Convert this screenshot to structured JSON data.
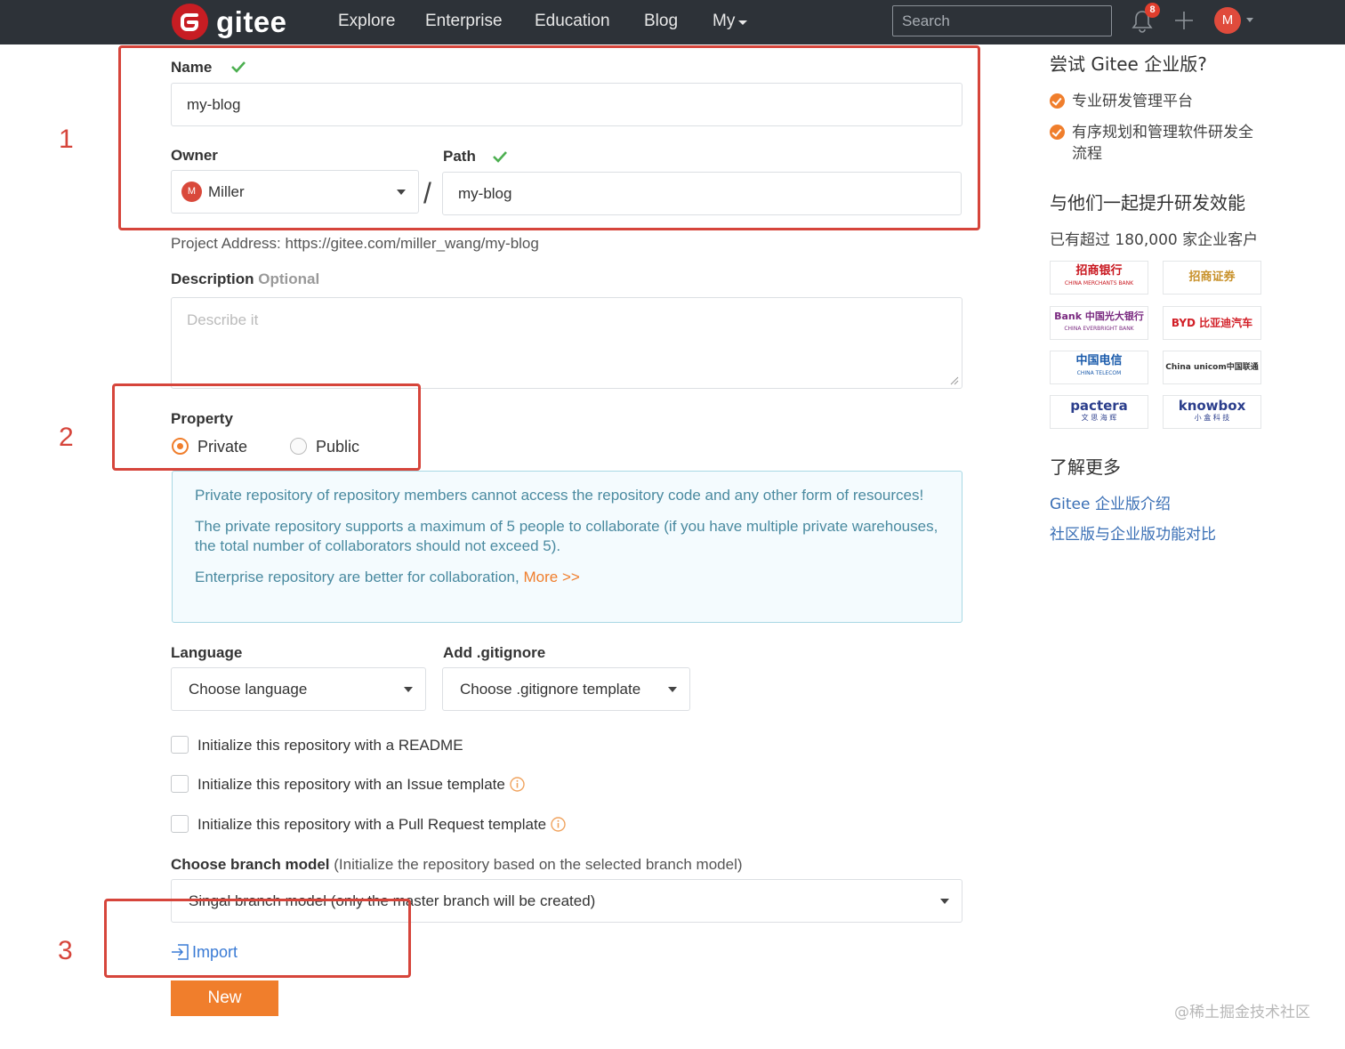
{
  "header": {
    "brand": "gitee",
    "nav": [
      "Explore",
      "Enterprise",
      "Education",
      "Blog",
      "My"
    ],
    "search_placeholder": "Search",
    "notification_count": "8",
    "avatar_initial": "M",
    "icons": [
      "gitee-logo-icon",
      "bell-icon",
      "plus-icon",
      "chevron-down-icon"
    ]
  },
  "form": {
    "name_label": "Name",
    "name_value": "my-blog",
    "owner_label": "Owner",
    "owner_avatar": "M",
    "owner_value": "Miller",
    "path_separator": "/",
    "path_label": "Path",
    "path_value": "my-blog",
    "project_address": "Project Address: https://gitee.com/miller_wang/my-blog",
    "description_label": "Description",
    "description_optional": "Optional",
    "description_placeholder": "Describe it",
    "property_label": "Property",
    "property_options": [
      {
        "label": "Private",
        "selected": true
      },
      {
        "label": "Public",
        "selected": false
      }
    ],
    "info": {
      "line1": "Private repository of repository members cannot access the repository code and any other form of resources!",
      "line2": "The private repository supports a maximum of 5 people to collaborate (if you have multiple private warehouses, the total number of collaborators should not exceed 5).",
      "line3": "Enterprise repository are better for collaboration,",
      "more_link": "More >>"
    },
    "language_label": "Language",
    "language_value": "Choose language",
    "gitignore_label": "Add .gitignore",
    "gitignore_value": "Choose .gitignore template",
    "checkboxes": [
      {
        "label": "Initialize this repository with a README",
        "checked": false,
        "info": false
      },
      {
        "label": "Initialize this repository with an Issue template",
        "checked": false,
        "info": true
      },
      {
        "label": "Initialize this repository with a Pull Request template",
        "checked": false,
        "info": true
      }
    ],
    "branch_label": "Choose branch model",
    "branch_hint": "(Initialize the repository based on the selected branch model)",
    "branch_value": "Singal branch model (only the master branch will be created)",
    "import_label": "Import",
    "new_button": "New"
  },
  "annotations": [
    "1",
    "2",
    "3"
  ],
  "sidebar": {
    "try_title": "尝试 Gitee 企业版?",
    "features": [
      "专业研发管理平台",
      "有序规划和管理软件研发全流程"
    ],
    "together_title": "与他们一起提升研发效能",
    "customers_text": "已有超过 180,000 家企业客户",
    "customer_logos": [
      {
        "text": "招商银行",
        "sub": "CHINA MERCHANTS BANK",
        "color": "#c8151d"
      },
      {
        "text": "招商证券",
        "sub": "",
        "color": "#c8912a"
      },
      {
        "text": "Bank 中国光大银行",
        "sub": "CHINA EVERBRIGHT BANK",
        "color": "#7a2a80"
      },
      {
        "text": "BYD 比亚迪汽车",
        "sub": "",
        "color": "#d21f27"
      },
      {
        "text": "中国电信",
        "sub": "CHINA TELECOM",
        "color": "#1a5bab"
      },
      {
        "text": "China unicom中国联通",
        "sub": "",
        "color": "#d21f27"
      },
      {
        "text": "pactera",
        "sub": "文 思 海 辉",
        "color": "#2b3e8c"
      },
      {
        "text": "knowbox",
        "sub": "小 盒 科 技",
        "color": "#2b3e8c"
      }
    ],
    "learn_title": "了解更多",
    "links": [
      "Gitee 企业版介绍",
      "社区版与企业版功能对比"
    ]
  },
  "watermark": "@稀土掘金技术社区",
  "colors": {
    "header_bg": "#2d3238",
    "accent": "#f07e2c",
    "annotation": "#d6453b",
    "link": "#3a6fb5",
    "check": "#4caf50"
  }
}
